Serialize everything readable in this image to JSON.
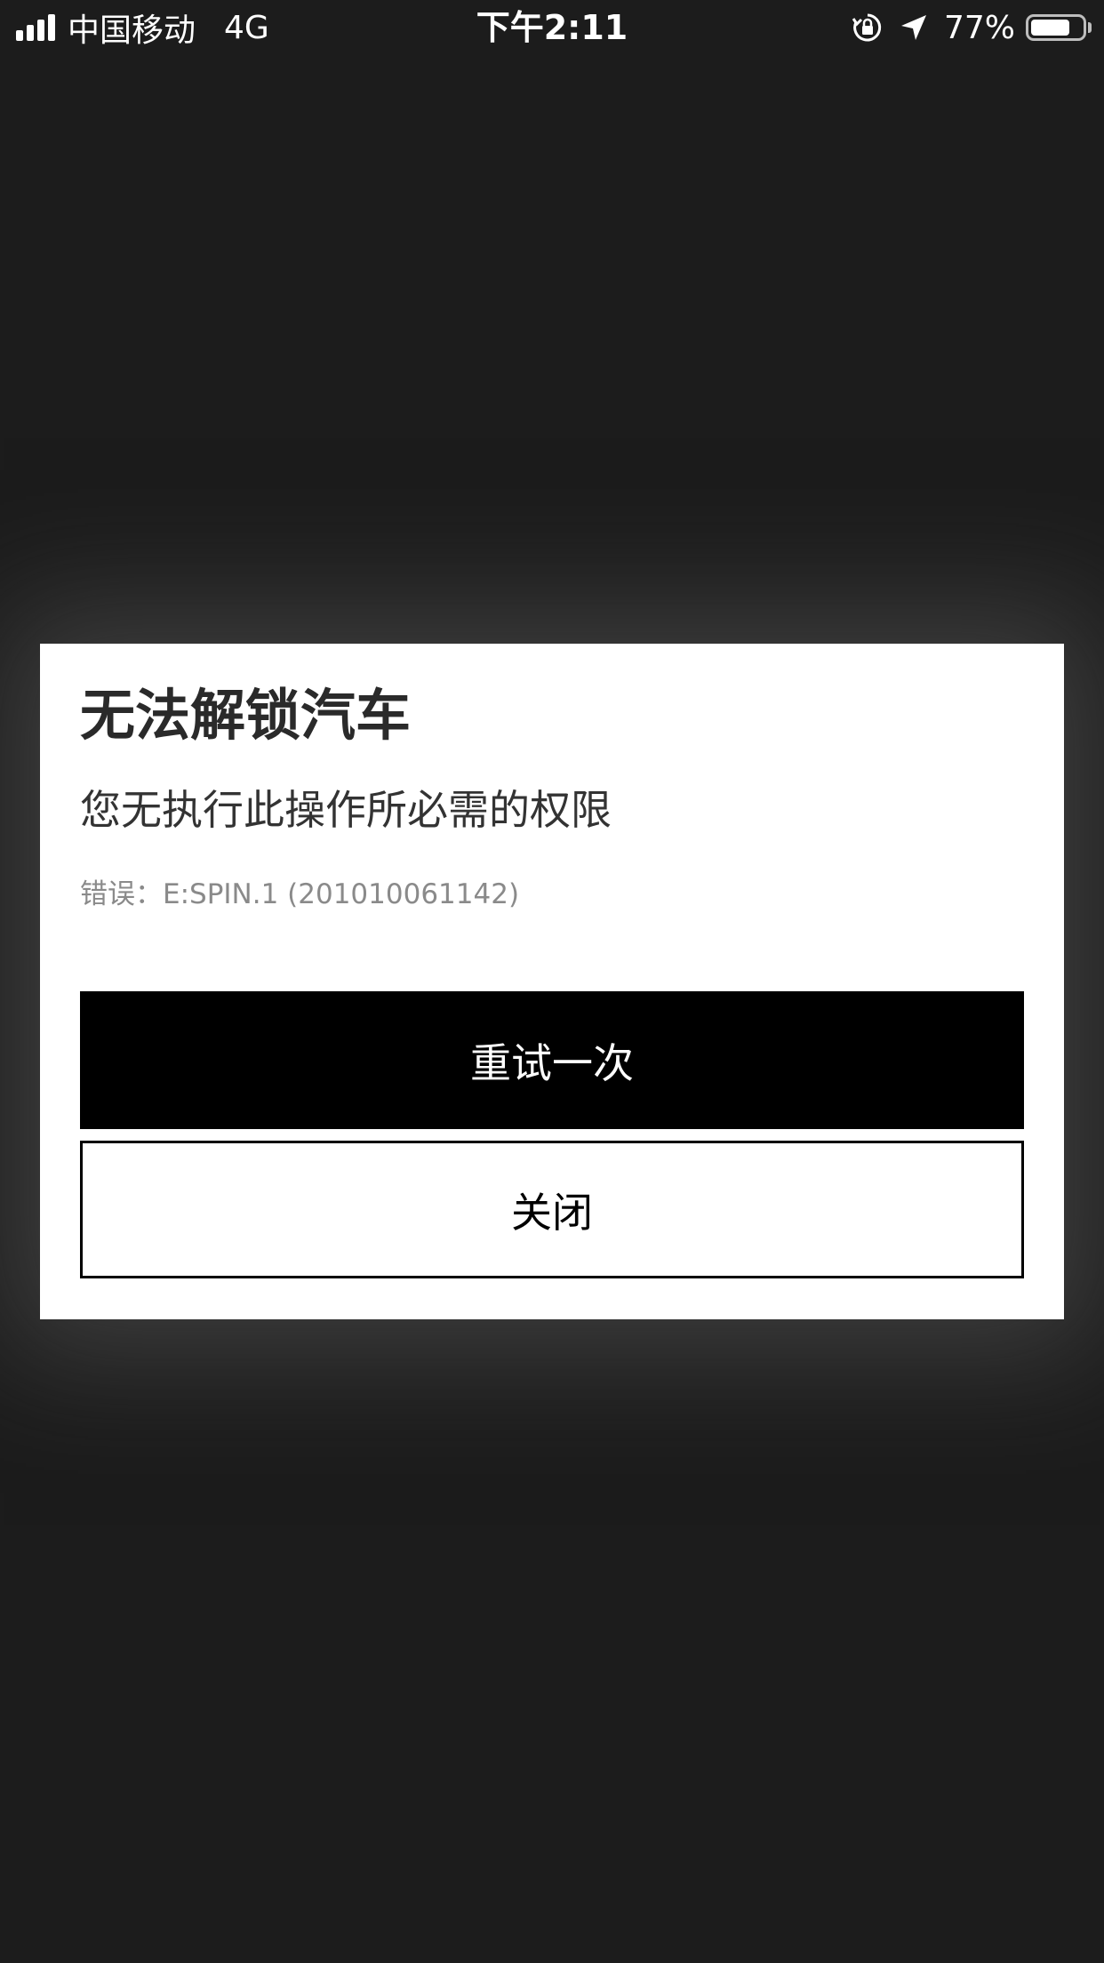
{
  "status_bar": {
    "carrier": "中国移动",
    "network": "4G",
    "time": "下午2:11",
    "battery_percent": "77%",
    "battery_level": 0.77,
    "icons": [
      "signal-icon",
      "orientation-lock-icon",
      "location-arrow-icon",
      "battery-icon"
    ]
  },
  "dialog": {
    "title": "无法解锁汽车",
    "message": "您无执行此操作所必需的权限",
    "error": "错误：E:SPIN.1 (201010061142)",
    "retry_label": "重试一次",
    "close_label": "关闭"
  },
  "colors": {
    "background": "#1c1c1c",
    "dialog": "#ffffff",
    "primary_button": "#000000",
    "secondary_text": "#8a8a8a"
  }
}
